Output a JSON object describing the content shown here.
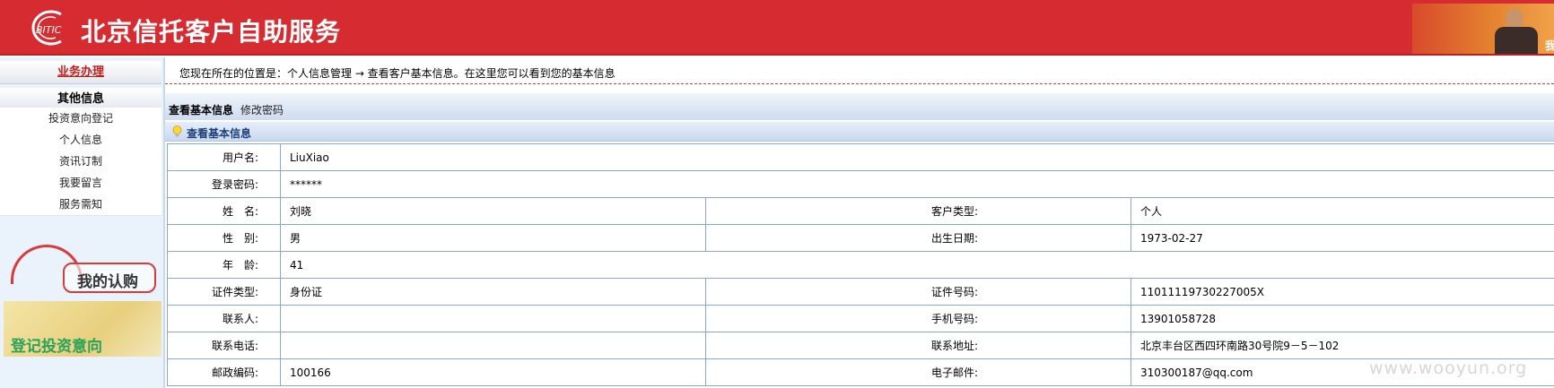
{
  "header": {
    "logo_text": "BITIC",
    "title": "北京信托客户自助服务",
    "corner_text": "我"
  },
  "sidebar": {
    "business": "业务办理",
    "other": "其他信息",
    "items": [
      {
        "label": "投资意向登记"
      },
      {
        "label": "个人信息"
      },
      {
        "label": "资讯订制"
      },
      {
        "label": "我要留言"
      },
      {
        "label": "服务需知"
      }
    ],
    "banner_buy": "我的认购",
    "banner_invest": "登记投资意向"
  },
  "breadcrumb": "您现在所在的位置是：个人信息管理 → 查看客户基本信息。在这里您可以看到您的基本信息",
  "tabs": {
    "view": "查看基本信息",
    "change": "修改密码"
  },
  "section_title": "查看基本信息",
  "rows": [
    {
      "label1": "用户名:",
      "value1": "LiuXiao"
    },
    {
      "label1": "登录密码:",
      "value1": "******"
    },
    {
      "label1": "姓　名:",
      "value1": "刘晓",
      "label2": "客户类型:",
      "value2": "个人"
    },
    {
      "label1": "性　别:",
      "value1": "男",
      "label2": "出生日期:",
      "value2": "1973-02-27"
    },
    {
      "label1": "年　龄:",
      "value1": "41"
    },
    {
      "label1": "证件类型:",
      "value1": "身份证",
      "label2": "证件号码:",
      "value2": "11011119730227005X"
    },
    {
      "label1": "联系人:",
      "value1": "",
      "label2": "手机号码:",
      "value2": "13901058728"
    },
    {
      "label1": "联系电话:",
      "value1": "",
      "label2": "联系地址:",
      "value2": "北京丰台区西四环南路30号院9－5－102"
    },
    {
      "label1": "邮政编码:",
      "value1": "100166",
      "label2": "电子邮件:",
      "value2": "310300187@qq.com"
    }
  ],
  "watermark": "www.wooyun.org",
  "colors": {
    "header_red": "#d62b30",
    "accent_blue": "#1c3f7a",
    "table_border": "#8aa8cf"
  }
}
